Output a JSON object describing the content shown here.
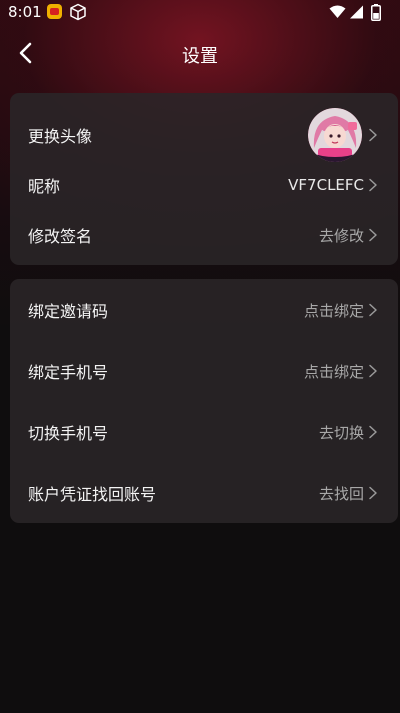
{
  "status_bar": {
    "time": "8:01",
    "icons": [
      "app-notification-icon",
      "cube-icon",
      "wifi-icon",
      "signal-icon",
      "battery-icon"
    ]
  },
  "header": {
    "title": "设置",
    "back_icon": "chevron-left-icon"
  },
  "profile_section": {
    "avatar_row": {
      "label": "更换头像"
    },
    "nickname_row": {
      "label": "昵称",
      "value": "VF7CLEFC"
    },
    "signature_row": {
      "label": "修改签名",
      "value": "去修改"
    }
  },
  "account_section": {
    "invite_row": {
      "label": "绑定邀请码",
      "value": "点击绑定"
    },
    "bind_phone_row": {
      "label": "绑定手机号",
      "value": "点击绑定"
    },
    "switch_phone_row": {
      "label": "切换手机号",
      "value": "去切换"
    },
    "recover_row": {
      "label": "账户凭证找回账号",
      "value": "去找回"
    }
  },
  "colors": {
    "background": "#0f0d0e",
    "header_glow": "#8c1626",
    "card": "#2a2628",
    "value_text": "#a8a8a8"
  }
}
